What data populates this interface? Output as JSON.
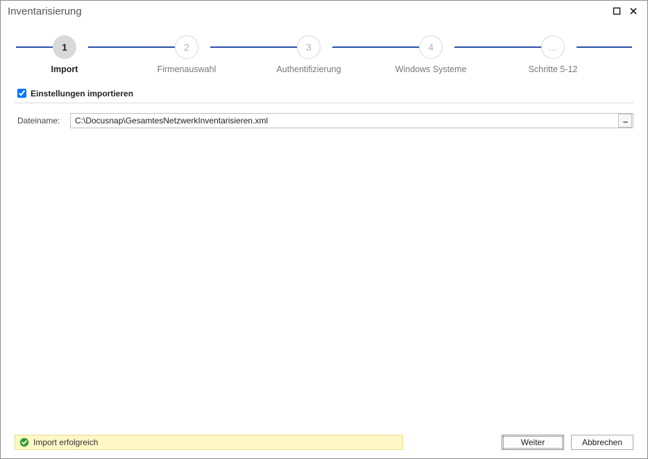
{
  "window": {
    "title": "Inventarisierung"
  },
  "steps": {
    "s1": {
      "num": "1",
      "label": "Import"
    },
    "s2": {
      "num": "2",
      "label": "Firmenauswahl"
    },
    "s3": {
      "num": "3",
      "label": "Authentifizierung"
    },
    "s4": {
      "num": "4",
      "label": "Windows Systeme"
    },
    "s5": {
      "num": "...",
      "label": "Schritte 5-12"
    }
  },
  "section": {
    "import_settings_label": "Einstellungen importieren"
  },
  "filename": {
    "label": "Dateiname:",
    "value": "C:\\Docusnap\\GesamtesNetzwerkInventarisieren.xml",
    "browse": "..."
  },
  "status": {
    "text": "Import erfolgreich"
  },
  "buttons": {
    "next": "Weiter",
    "cancel": "Abbrechen"
  }
}
